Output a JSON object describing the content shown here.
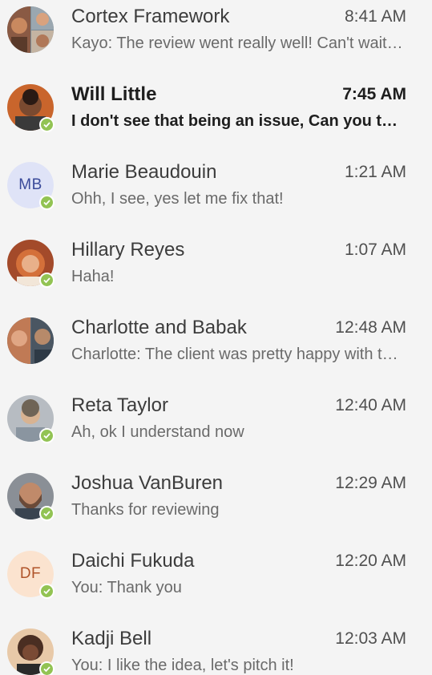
{
  "conversations": [
    {
      "name": "Cortex Framework",
      "time": "8:41 AM",
      "preview": "Kayo: The review went really well! Can't wait to get started",
      "unread": false,
      "avatar": {
        "type": "group-photo",
        "colors": [
          "#8a5a44",
          "#d9a27e"
        ]
      },
      "presence": null
    },
    {
      "name": "Will Little",
      "time": "7:45 AM",
      "preview": "I don't see that being an issue, Can you take a look",
      "unread": true,
      "avatar": {
        "type": "photo",
        "colors": [
          "#c9652c",
          "#7a4a30"
        ]
      },
      "presence": "available"
    },
    {
      "name": "Marie Beaudouin",
      "time": "1:21 AM",
      "preview": "Ohh, I see, yes let me fix that!",
      "unread": false,
      "avatar": {
        "type": "initials",
        "initials": "MB",
        "bg": "#dfe3f7",
        "fg": "#3a4a9a"
      },
      "presence": "available"
    },
    {
      "name": "Hillary Reyes",
      "time": "1:07 AM",
      "preview": "Haha!",
      "unread": false,
      "avatar": {
        "type": "photo",
        "colors": [
          "#d4703a",
          "#a34a2a"
        ]
      },
      "presence": "available"
    },
    {
      "name": "Charlotte and Babak",
      "time": "12:48 AM",
      "preview": "Charlotte: The client was pretty happy with the results",
      "unread": false,
      "avatar": {
        "type": "group-photo",
        "colors": [
          "#c07a55",
          "#5a6a7a"
        ]
      },
      "presence": null
    },
    {
      "name": "Reta Taylor",
      "time": "12:40 AM",
      "preview": "Ah, ok I understand now",
      "unread": false,
      "avatar": {
        "type": "photo",
        "colors": [
          "#b7bcc2",
          "#6f6456"
        ]
      },
      "presence": "available"
    },
    {
      "name": "Joshua VanBuren",
      "time": "12:29 AM",
      "preview": "Thanks for reviewing",
      "unread": false,
      "avatar": {
        "type": "photo",
        "colors": [
          "#c08a6a",
          "#6a4a38"
        ]
      },
      "presence": "available"
    },
    {
      "name": "Daichi Fukuda",
      "time": "12:20 AM",
      "preview": "You: Thank you",
      "unread": false,
      "avatar": {
        "type": "initials",
        "initials": "DF",
        "bg": "#fbe3cf",
        "fg": "#b0542a"
      },
      "presence": "available"
    },
    {
      "name": "Kadji Bell",
      "time": "12:03 AM",
      "preview": "You: I like the idea, let's pitch it!",
      "unread": false,
      "avatar": {
        "type": "photo",
        "colors": [
          "#4a2e22",
          "#e8c9a8"
        ]
      },
      "presence": "available"
    }
  ]
}
